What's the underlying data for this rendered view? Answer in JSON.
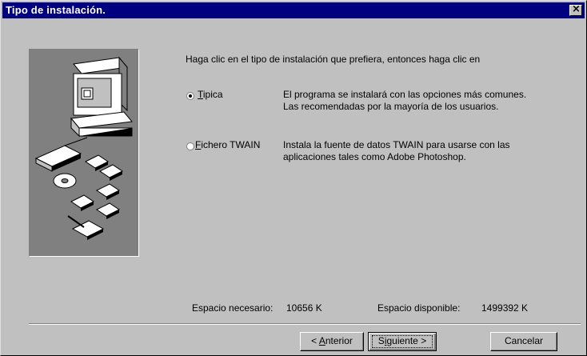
{
  "window": {
    "title": "Tipo de instalación."
  },
  "close": {
    "symbol": "×"
  },
  "instruction": "Haga clic en el tipo de instalación que prefiera, entonces haga clic en",
  "options": [
    {
      "mnemonic": "T",
      "rest": "ipica",
      "selected": true,
      "desc_line1": "El programa se instalará con las opciones más comunes.",
      "desc_line2": "Las recomendadas por la mayoría de los usuarios."
    },
    {
      "mnemonic": "F",
      "rest": "ichero TWAIN",
      "selected": false,
      "desc_line1": "Instala la fuente de datos TWAIN para usarse con las",
      "desc_line2": "aplicaciones tales como Adobe Photoshop."
    }
  ],
  "space": {
    "required_label": "Espacio necesario:",
    "required_value": "10656 K",
    "available_label": "Espacio disponible:",
    "available_value": "1499392 K"
  },
  "buttons": {
    "back_prefix": "< ",
    "back_mnemonic": "A",
    "back_rest": "nterior",
    "next_prefix": "S",
    "next_mnemonic": "i",
    "next_rest": "guiente >",
    "cancel": "Cancelar"
  },
  "icons": [
    "computer-icon",
    "scanner-icon",
    "floppy-disk-icon",
    "cd-icon",
    "document-icon"
  ]
}
